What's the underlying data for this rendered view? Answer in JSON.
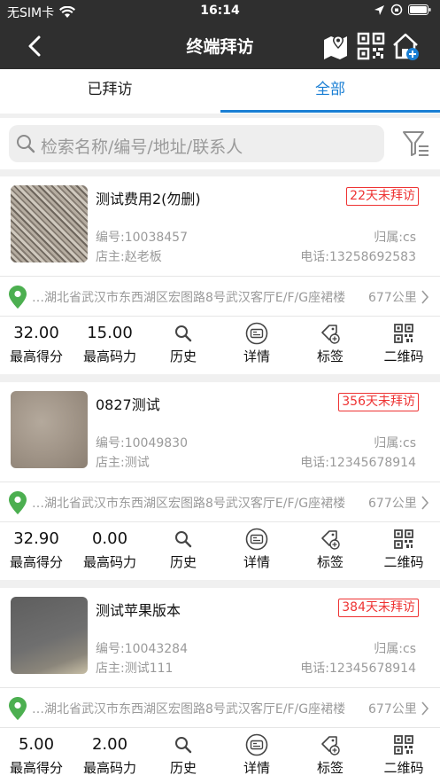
{
  "status": {
    "carrier": "无SIM卡",
    "time": "16:14"
  },
  "nav": {
    "title": "终端拜访"
  },
  "tabs": [
    {
      "label": "已拜访"
    },
    {
      "label": "全部"
    }
  ],
  "search": {
    "placeholder": "检索名称/编号/地址/联系人"
  },
  "labels": {
    "max_score": "最高得分",
    "max_power": "最高码力",
    "history": "历史",
    "details": "详情",
    "tag": "标签",
    "qrcode": "二维码"
  },
  "cards": [
    {
      "name": "测试费用2(勿删)",
      "badge": "22天未拜访",
      "code": "编号:10038457",
      "owner": "店主:赵老板",
      "belong": "归属:cs",
      "phone": "电话:13258692583",
      "address": "…湖北省武汉市东西湖区宏图路8号武汉客厅E/F/G座裙楼",
      "distance": "677公里",
      "max_score": "32.00",
      "max_power": "15.00"
    },
    {
      "name": "0827测试",
      "badge": "356天未拜访",
      "code": "编号:10049830",
      "owner": "店主:测试",
      "belong": "归属:cs",
      "phone": "电话:12345678914",
      "address": "…湖北省武汉市东西湖区宏图路8号武汉客厅E/F/G座裙楼",
      "distance": "677公里",
      "max_score": "32.90",
      "max_power": "0.00"
    },
    {
      "name": "测试苹果版本",
      "badge": "384天未拜访",
      "code": "编号:10043284",
      "owner": "店主:测试111",
      "belong": "归属:cs",
      "phone": "电话:12345678914",
      "address": "…湖北省武汉市东西湖区宏图路8号武汉客厅E/F/G座裙楼",
      "distance": "677公里",
      "max_score": "5.00",
      "max_power": "2.00"
    }
  ],
  "colors": {
    "accent": "#1a7fd4",
    "warning": "#e33333",
    "pin": "#4caf50",
    "nav": "#2f2f2f"
  }
}
